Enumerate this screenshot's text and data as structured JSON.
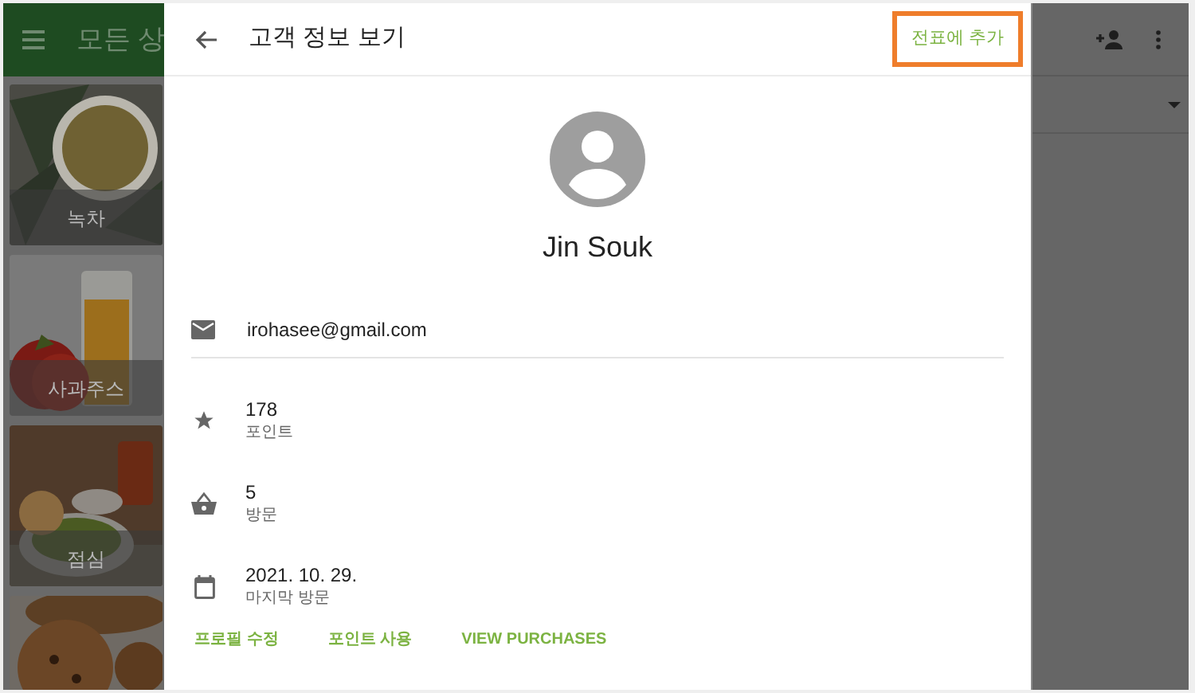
{
  "background_app": {
    "title": "모든 상",
    "products": [
      {
        "kind": "picture",
        "name": "녹차"
      },
      {
        "kind": "picture",
        "name": "사과주스"
      },
      {
        "kind": "picture",
        "name": "점심"
      },
      {
        "kind": "picture"
      }
    ]
  },
  "dialog": {
    "title": "고객 정보 보기",
    "header_action": {
      "label": "전표에 추가",
      "highlighted": true
    },
    "customer": {
      "name": "Jin Souk",
      "email": "irohasee@gmail.com"
    },
    "details": [
      {
        "kind": "points",
        "value": "178",
        "label": "포인트"
      },
      {
        "kind": "visits",
        "value": "5",
        "label": "방문"
      },
      {
        "kind": "last_visit",
        "value": "2021. 10. 29.",
        "label": "마지막 방문"
      }
    ],
    "actions": [
      "프로필 수정",
      "포인트 사용",
      "VIEW PURCHASES"
    ]
  }
}
